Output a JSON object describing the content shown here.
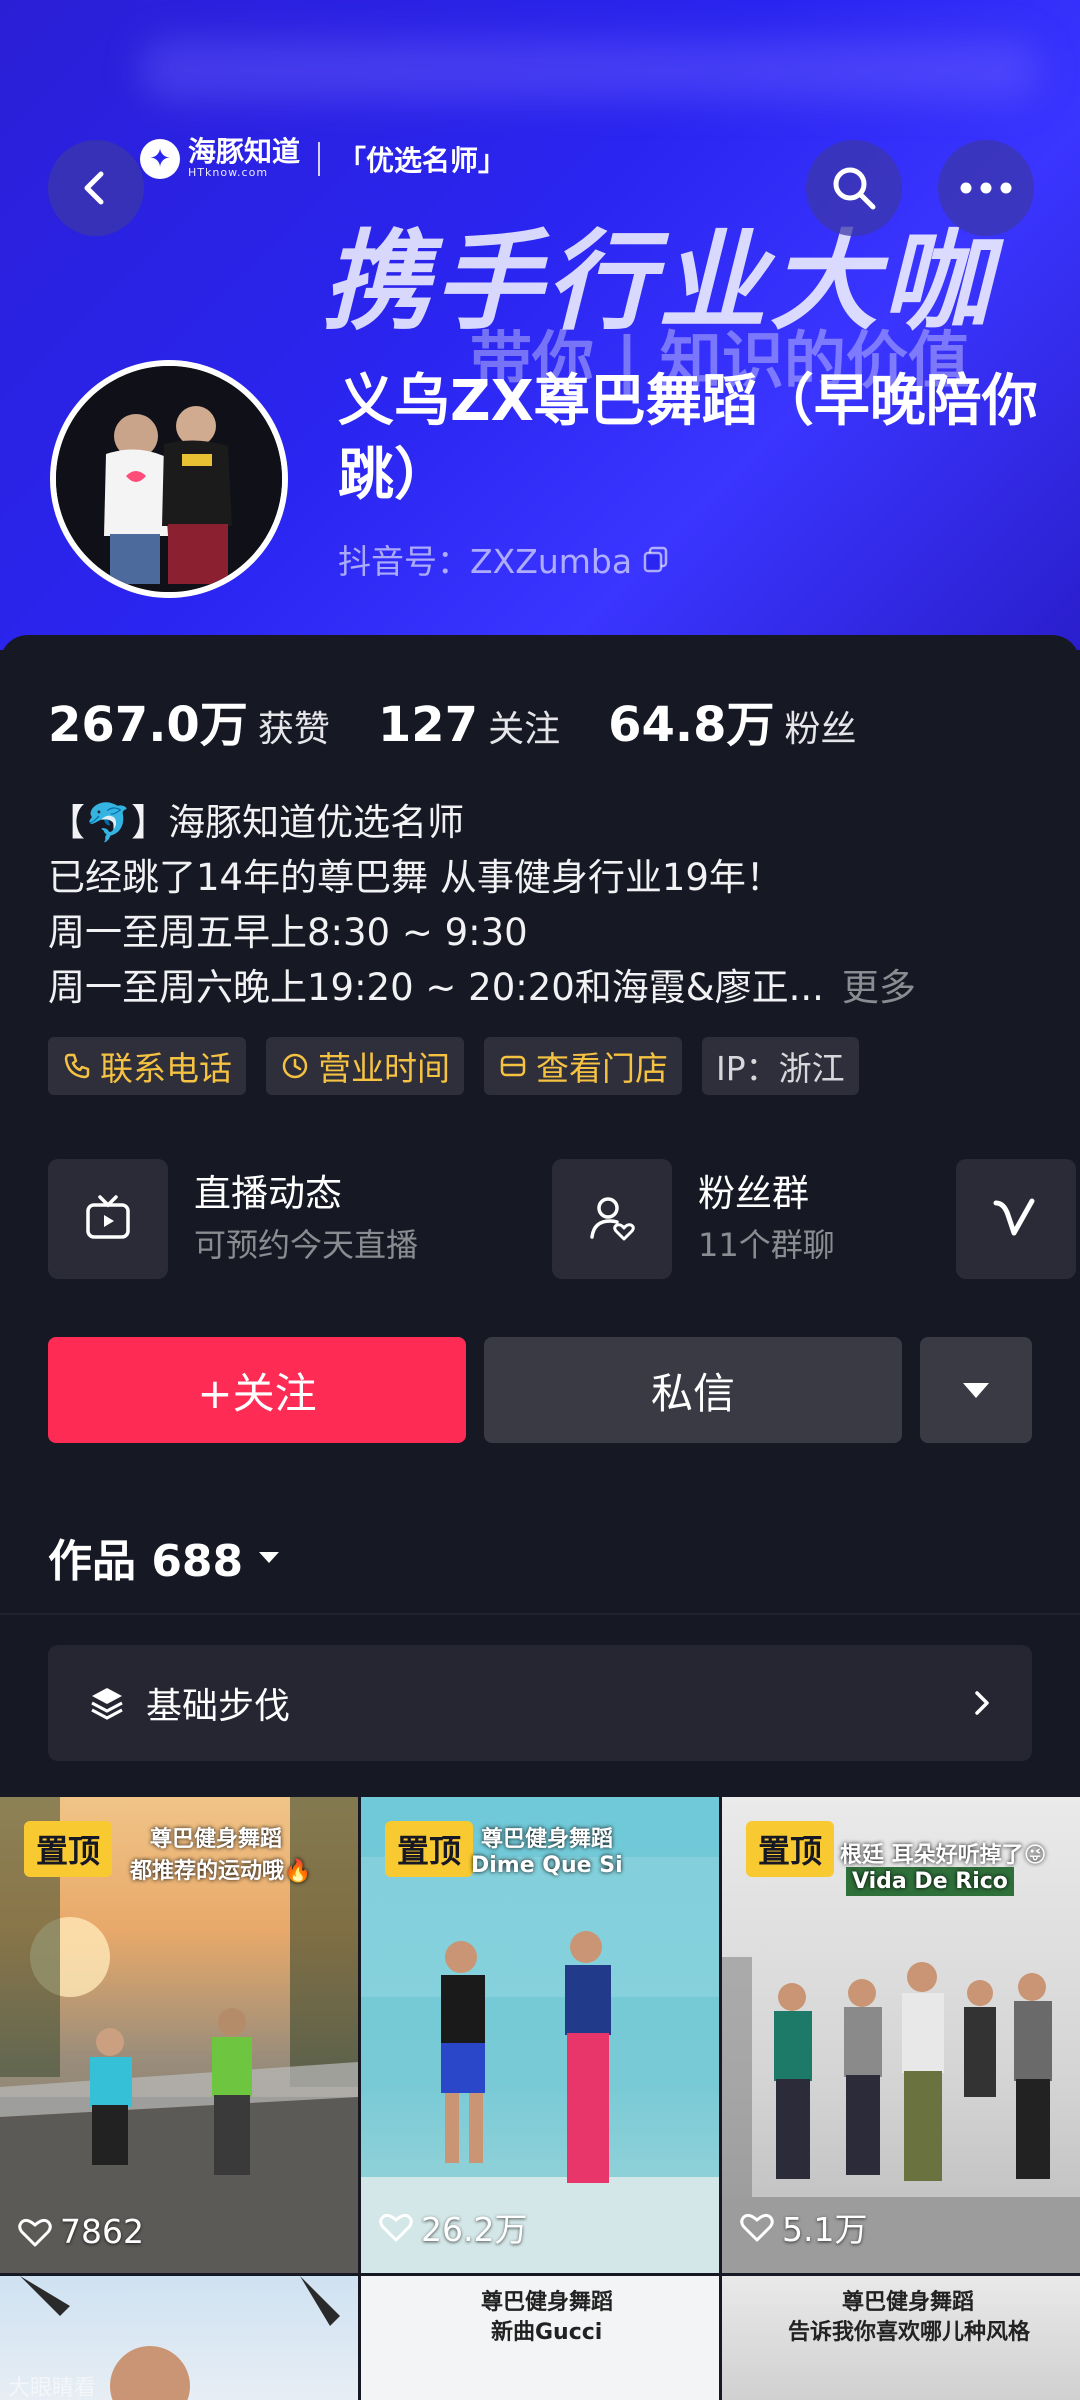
{
  "banner": {
    "brand_name": "海豚知道",
    "brand_sub": "HTknow.com",
    "brand_tag": "「优选名师」",
    "slogan": "携手行业大咖",
    "sub_slogan": "带你 | 知识的价值"
  },
  "profile": {
    "name": "义乌ZX尊巴舞蹈（早晚陪你跳）",
    "douyin_id": "抖音号：ZXZumba"
  },
  "stats": [
    {
      "num": "267.0万",
      "label": "获赞"
    },
    {
      "num": "127",
      "label": "关注"
    },
    {
      "num": "64.8万",
      "label": "粉丝"
    }
  ],
  "bio": {
    "line1": "【🐬】海豚知道优选名师",
    "line2": "已经跳了14年的尊巴舞 从事健身行业19年！",
    "line3": "周一至周五早上8:30 ~ 9:30",
    "line4": "周一至周六晚上19:20 ~ 20:20和海霞&廖正...",
    "more": "更多"
  },
  "tags": {
    "phone": "联系电话",
    "hours": "营业时间",
    "store": "查看门店",
    "ip": "IP：浙江"
  },
  "cards": {
    "live_title": "直播动态",
    "live_sub": "可预约今天直播",
    "fans_title": "粉丝群",
    "fans_sub": "11个群聊"
  },
  "actions": {
    "follow": "+关注",
    "message": "私信"
  },
  "works": {
    "label": "作品 688"
  },
  "collection": {
    "label": "基础步伐"
  },
  "videos": [
    {
      "pin": "置顶",
      "caption": "尊巴健身舞蹈",
      "caption2": "都推荐的运动哦🔥",
      "likes": "7862"
    },
    {
      "pin": "置顶",
      "caption": "尊巴健身舞蹈",
      "caption2": "Dime Que Si",
      "likes": "26.2万"
    },
    {
      "pin": "置顶",
      "caption": "根廷 耳朵好听掉了😜",
      "caption2": "Vida De Rico",
      "likes": "5.1万"
    },
    {
      "caption": "",
      "caption2": ""
    },
    {
      "caption": "尊巴健身舞蹈",
      "caption2": "新曲Gucci"
    },
    {
      "caption": "尊巴健身舞蹈",
      "caption2": "告诉我你喜欢哪儿种风格"
    }
  ],
  "watermark": "大眼睛看",
  "colors": {
    "banner": "#2a25f0",
    "background": "#161823",
    "follow": "#fe2c55",
    "tag_text": "#f5c242",
    "pin": "#f9c932"
  }
}
